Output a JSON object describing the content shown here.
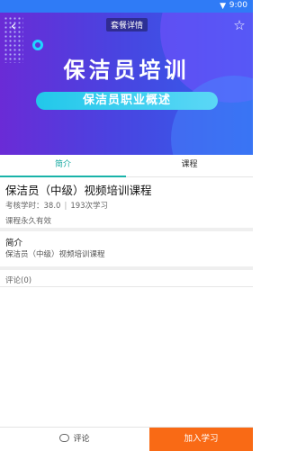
{
  "status_bar": {
    "time": "9:00"
  },
  "header": {
    "title": "套餐详情"
  },
  "banner": {
    "main_text": "保洁员培训",
    "pill_text": "保洁员职业概述"
  },
  "tabs": [
    {
      "label": "简介",
      "active": true
    },
    {
      "label": "课程",
      "active": false
    }
  ],
  "course": {
    "title": "保洁员（中级）视频培训课程",
    "study_hours_label": "考核学时：38.0",
    "learners": "193次学习",
    "validity": "课程永久有效"
  },
  "intro": {
    "heading": "简介",
    "text": "保洁员（中级）视频培训课程"
  },
  "comments": {
    "heading": "评论(0)"
  },
  "bottom_bar": {
    "comment_label": "评论",
    "join_label": "加入学习"
  },
  "colors": {
    "accent_teal": "#19b3a9",
    "join_orange": "#f96a15",
    "status_blue": "#2f7bf6"
  }
}
